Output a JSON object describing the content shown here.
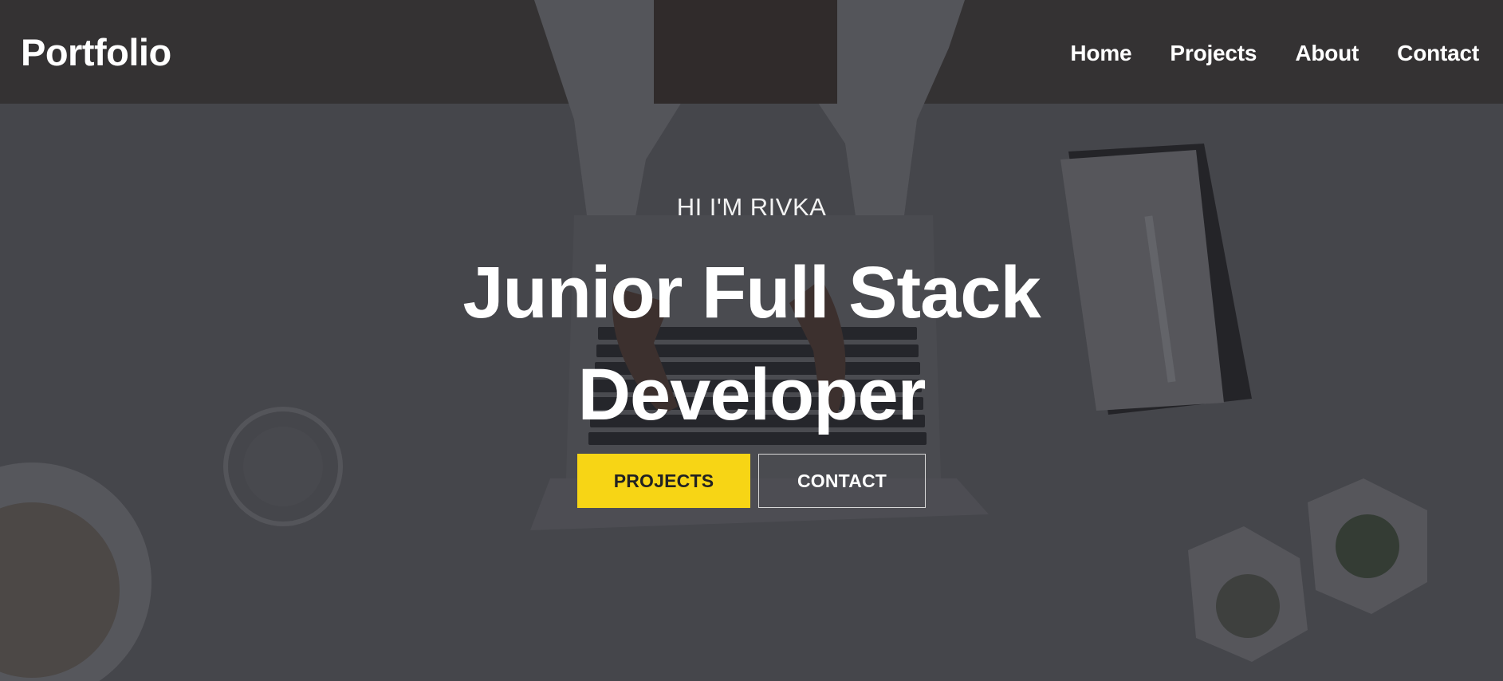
{
  "navbar": {
    "brand": "Portfolio",
    "links": [
      "Home",
      "Projects",
      "About",
      "Contact"
    ]
  },
  "hero": {
    "greeting": "HI I'M RIVKA",
    "headline_line1": "Junior Full Stack",
    "headline_line2": "Developer",
    "primary_button": "PROJECTS",
    "secondary_button": "CONTACT"
  },
  "colors": {
    "accent": "#f7d515",
    "text": "#ffffff",
    "overlay": "#3c3d42"
  }
}
